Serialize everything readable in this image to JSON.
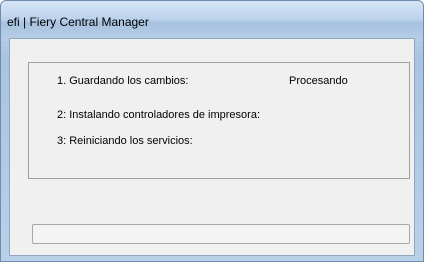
{
  "window": {
    "title": "efi | Fiery Central Manager"
  },
  "steps": [
    {
      "label": "1. Guardando los cambios:",
      "status": "Procesando"
    },
    {
      "label": "2: Instalando controladores de impresora:",
      "status": ""
    },
    {
      "label": "3: Reiniciando los servicios:",
      "status": ""
    }
  ],
  "progress": {
    "fraction": 0
  }
}
